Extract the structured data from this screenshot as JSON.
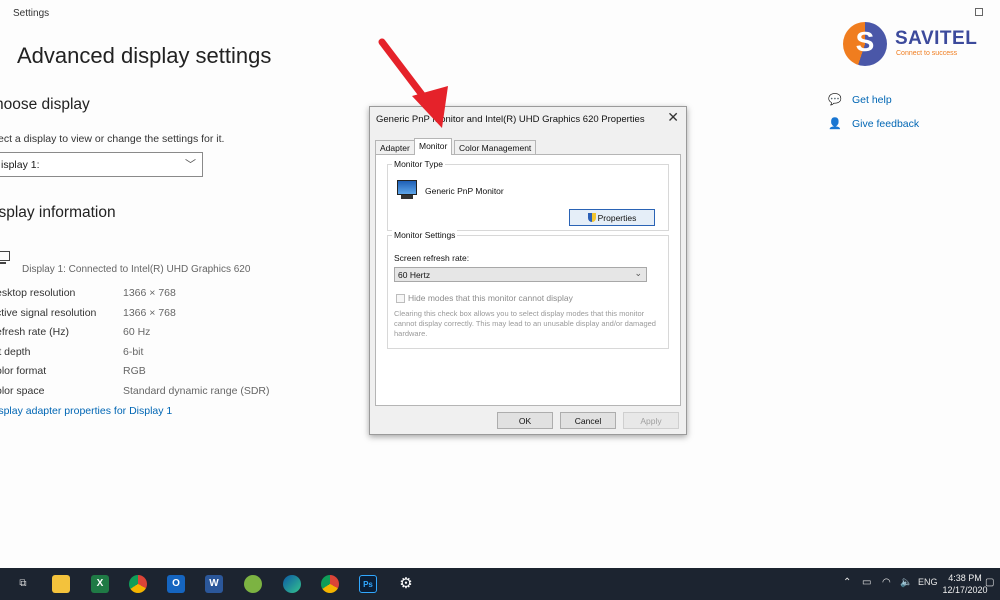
{
  "settings": {
    "window_title": "Settings",
    "page_title": "Advanced display settings",
    "choose_display_heading": "hoose display",
    "choose_display_sub": "ect a display to view or change the settings for it.",
    "display_select_value": "isplay 1:",
    "display_info_heading": "isplay information",
    "connected_text": "Display 1: Connected to Intel(R) UHD Graphics 620",
    "info_rows": [
      {
        "key": "esktop resolution",
        "value": "1366 × 768"
      },
      {
        "key": "ctive signal resolution",
        "value": "1366 × 768"
      },
      {
        "key": "efresh rate (Hz)",
        "value": "60 Hz"
      },
      {
        "key": "it depth",
        "value": "6-bit"
      },
      {
        "key": "olor format",
        "value": "RGB"
      },
      {
        "key": "olor space",
        "value": "Standard dynamic range (SDR)"
      }
    ],
    "adapter_link": "isplay adapter properties for Display 1",
    "get_help": "Get help",
    "give_feedback": "Give feedback"
  },
  "logo": {
    "brand": "SAVITEL",
    "tagline": "Connect to success",
    "colors": {
      "blue": "#3c4a9c",
      "orange": "#f07d1f"
    }
  },
  "dialog": {
    "title": "Generic PnP Monitor and Intel(R) UHD Graphics 620 Properties",
    "tabs": [
      "Adapter",
      "Monitor",
      "Color Management"
    ],
    "active_tab": "Monitor",
    "monitor_type_label": "Monitor Type",
    "monitor_name": "Generic PnP Monitor",
    "properties_button": "Properties",
    "monitor_settings_label": "Monitor Settings",
    "refresh_rate_label": "Screen refresh rate:",
    "refresh_rate_value": "60 Hertz",
    "hide_modes_label": "Hide modes that this monitor cannot display",
    "hide_modes_desc": "Clearing this check box allows you to select display modes that this monitor cannot display correctly. This may lead to an unusable display and/or damaged hardware.",
    "ok": "OK",
    "cancel": "Cancel",
    "apply": "Apply"
  },
  "taskbar": {
    "icons": [
      "task-view-icon",
      "file-explorer-icon",
      "excel-icon",
      "chrome-icon",
      "outlook-icon",
      "word-icon",
      "greenshot-icon",
      "edge-icon",
      "chrome-icon",
      "photoshop-icon",
      "settings-gear-icon"
    ],
    "language": "ENG",
    "time": "4:38 PM",
    "date": "12/17/2020"
  }
}
